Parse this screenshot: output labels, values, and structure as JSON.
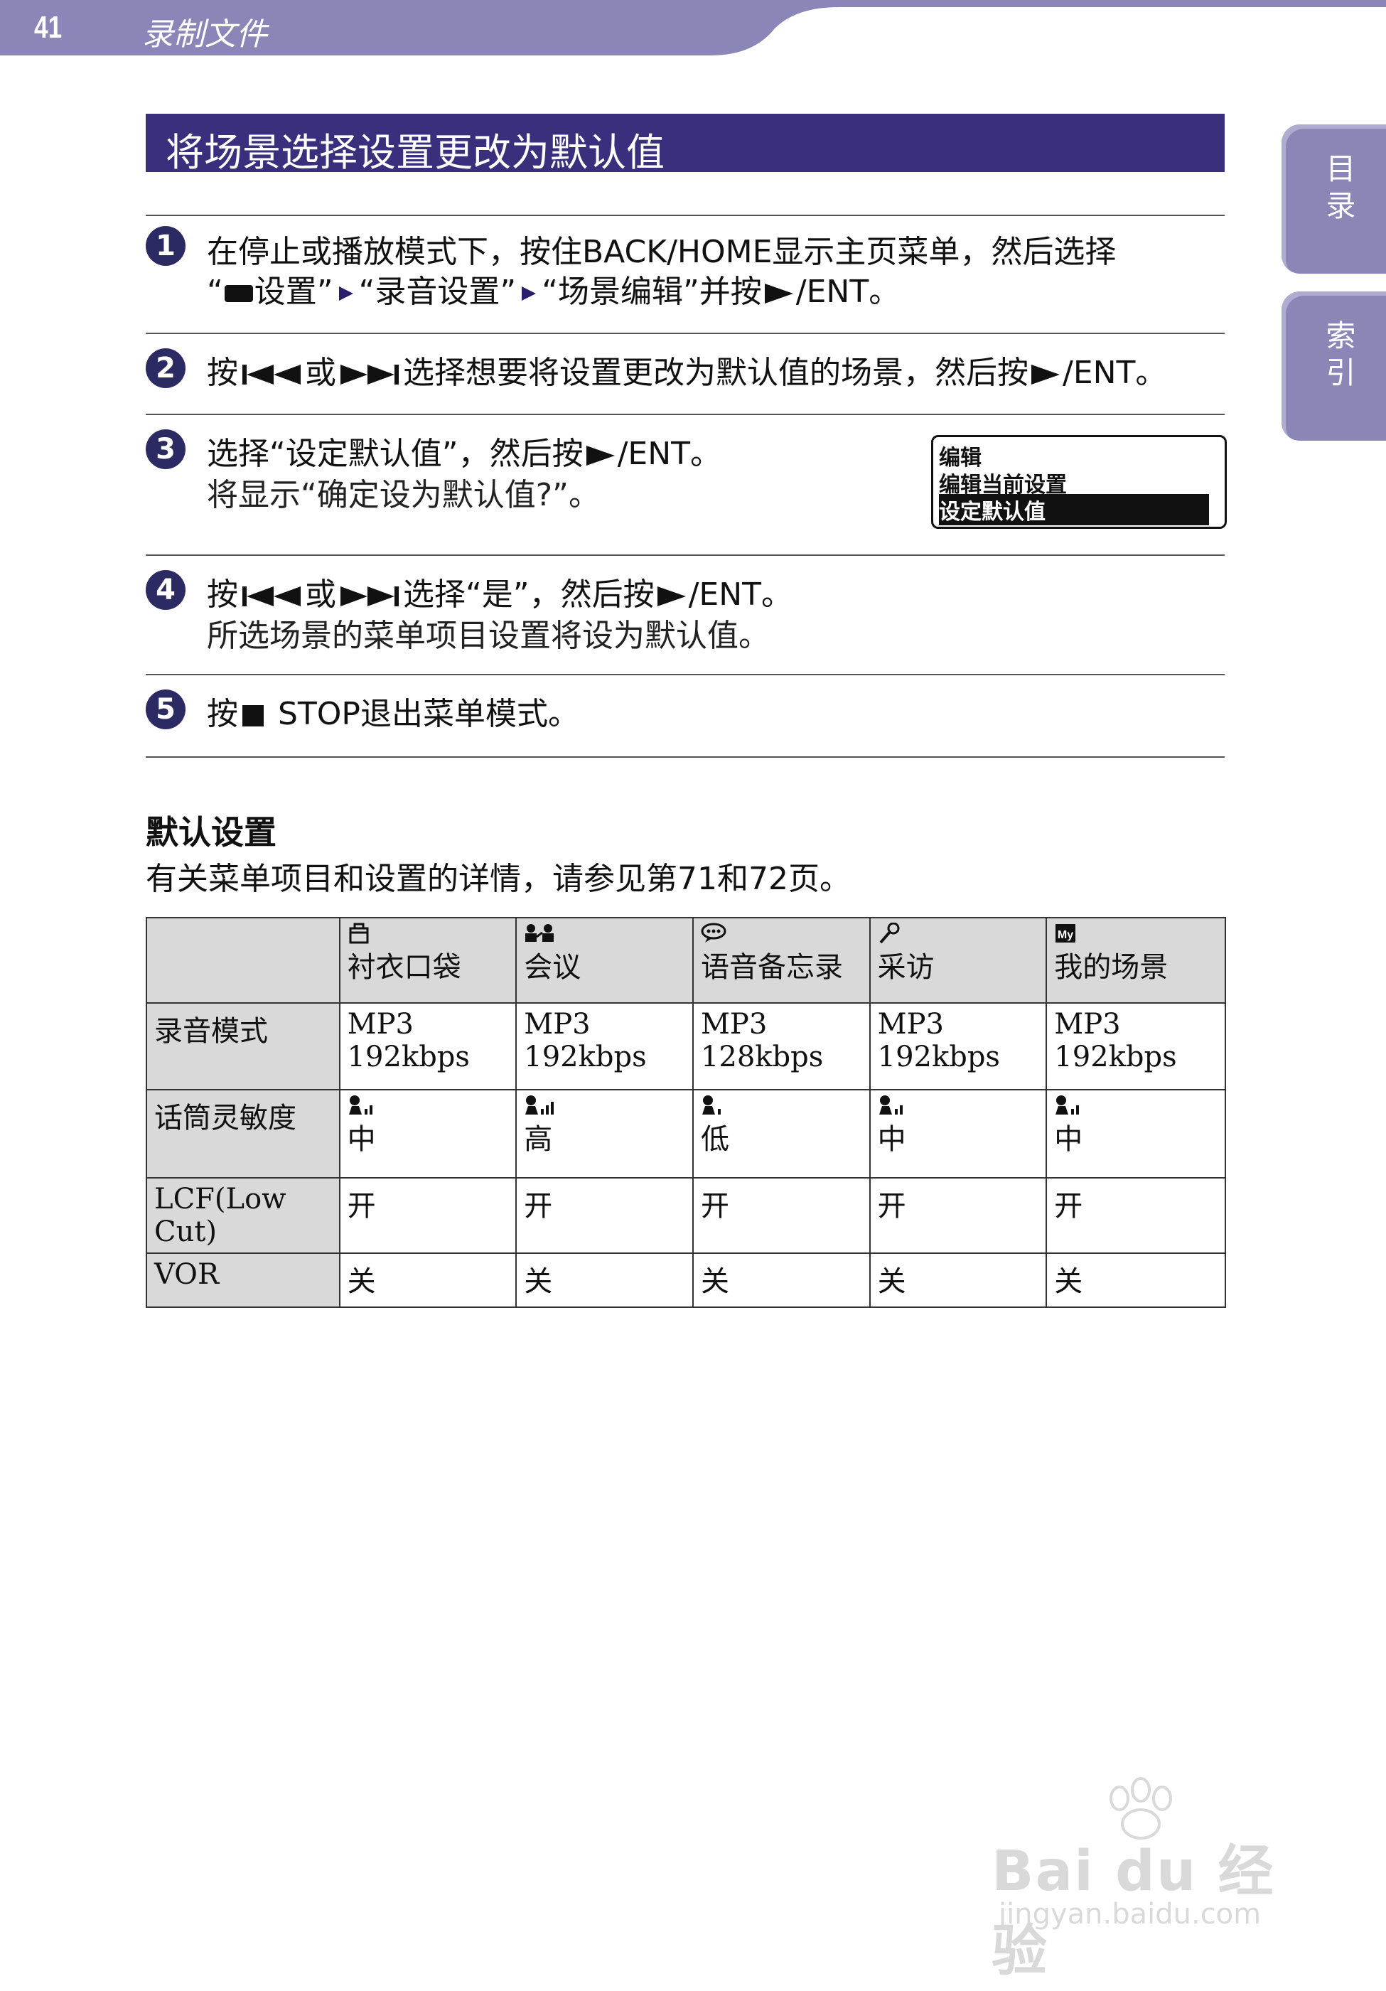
{
  "header": {
    "page_number": "41",
    "section": "录制文件"
  },
  "side_tabs": {
    "toc": "目录",
    "index": "索引"
  },
  "title": "将场景选择设置更改为默认值",
  "steps": [
    {
      "num": "1",
      "line1": "在停止或播放模式下，按住BACK/HOME显示主页菜单，然后选择",
      "line2_a": "“",
      "line2_b": "设置”",
      "line2_c": "“录音设置”",
      "line2_d": "“场景编辑”并按",
      "line2_e": "/ENT。"
    },
    {
      "num": "2",
      "t1": "按",
      "t2": "或",
      "t3": "选择想要将设置更改为默认值的场景，然后按",
      "t4": "/ENT。"
    },
    {
      "num": "3",
      "t1": "选择“设定默认值”，然后按",
      "t2": "/ENT。",
      "sub": "将显示“确定设为默认值?”。"
    },
    {
      "num": "4",
      "t1": "按",
      "t2": "或",
      "t3": "选择“是”，然后按",
      "t4": "/ENT。",
      "sub": "所选场景的菜单项目设置将设为默认值。"
    },
    {
      "num": "5",
      "t1": "按",
      "t2": " STOP退出菜单模式。"
    }
  ],
  "lcd": {
    "row1": "编辑",
    "row2": "编辑当前设置",
    "row3": "设定默认值"
  },
  "defaults": {
    "title": "默认设置",
    "desc": "有关菜单项目和设置的详情，请参见第71和72页。",
    "columns": [
      "衬衣口袋",
      "会议",
      "语音备忘录",
      "采访",
      "我的场景"
    ],
    "column_icons": [
      "pocket-icon",
      "meeting-icon",
      "voice-memo-icon",
      "interview-icon",
      "my-scene-icon"
    ],
    "my_scene_badge": "My",
    "rows": [
      {
        "label": "录音模式",
        "cells": [
          [
            "MP3",
            "192kbps"
          ],
          [
            "MP3",
            "192kbps"
          ],
          [
            "MP3",
            "128kbps"
          ],
          [
            "MP3",
            "192kbps"
          ],
          [
            "MP3",
            "192kbps"
          ]
        ]
      },
      {
        "label": "话筒灵敏度",
        "cells": [
          "中",
          "高",
          "低",
          "中",
          "中"
        ],
        "levels": [
          2,
          3,
          1,
          2,
          2
        ]
      },
      {
        "label": "LCF(Low Cut)",
        "cells": [
          "开",
          "开",
          "开",
          "开",
          "开"
        ]
      },
      {
        "label": "VOR",
        "cells": [
          "关",
          "关",
          "关",
          "关",
          "关"
        ]
      }
    ]
  },
  "watermark": {
    "brand": "Bai du 经验",
    "url": "jingyan.baidu.com"
  }
}
